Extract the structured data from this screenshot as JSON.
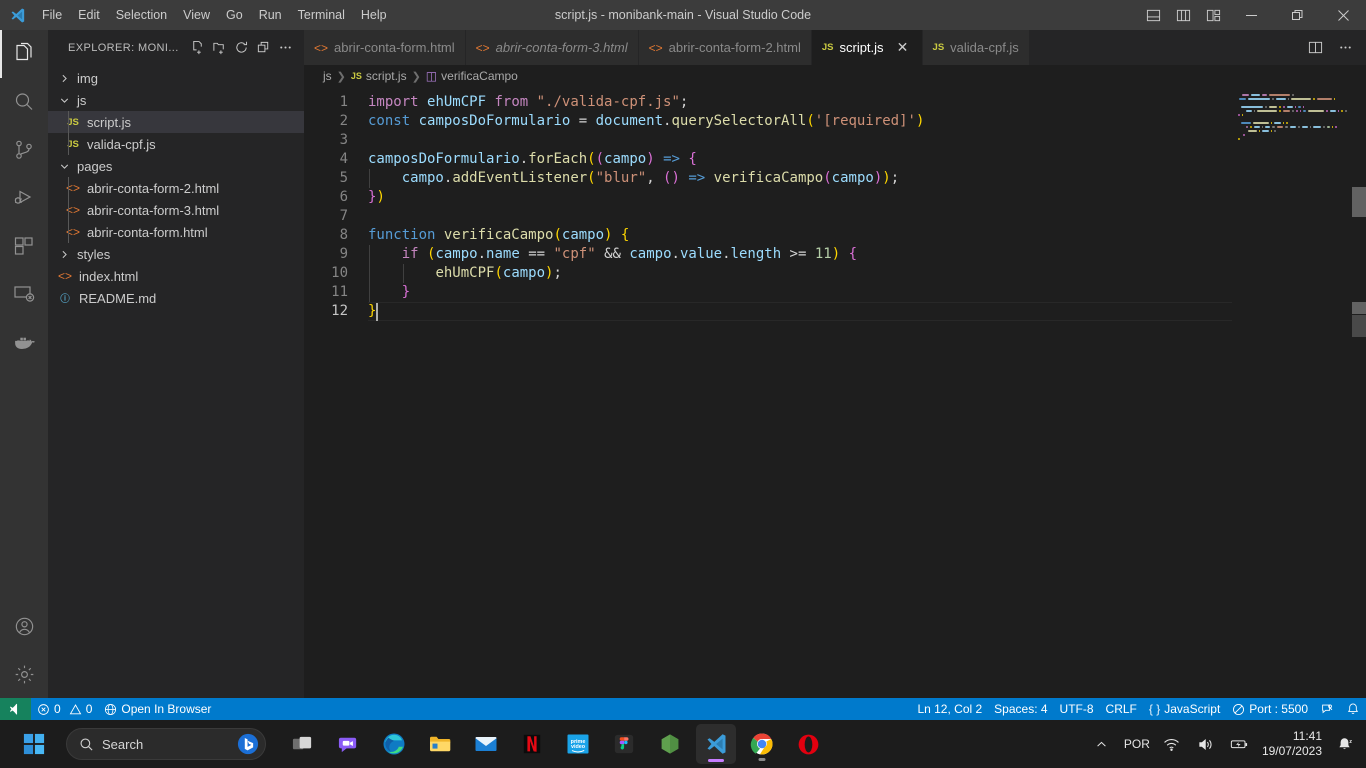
{
  "window": {
    "title": "script.js - monibank-main - Visual Studio Code",
    "menus": [
      "File",
      "Edit",
      "Selection",
      "View",
      "Go",
      "Run",
      "Terminal",
      "Help"
    ],
    "controls": {
      "minimize": "minimize-button",
      "restore": "restore-button",
      "close": "close-button"
    },
    "layout_toggles": [
      "toggle-primary-sidebar",
      "toggle-panel",
      "toggle-secondary-sidebar",
      "customize-layout"
    ]
  },
  "activitybar": {
    "items": [
      {
        "name": "explorer",
        "icon": "files-icon",
        "active": true
      },
      {
        "name": "search",
        "icon": "search-icon",
        "active": false
      },
      {
        "name": "source-control",
        "icon": "source-control-icon",
        "active": false
      },
      {
        "name": "run-and-debug",
        "icon": "debug-icon",
        "active": false
      },
      {
        "name": "extensions",
        "icon": "extensions-icon",
        "active": false
      },
      {
        "name": "remote-explorer",
        "icon": "remote-explorer-icon",
        "active": false
      },
      {
        "name": "docker",
        "icon": "docker-icon",
        "active": false
      }
    ],
    "bottom": [
      {
        "name": "accounts",
        "icon": "account-icon"
      },
      {
        "name": "manage-settings",
        "icon": "gear-icon"
      }
    ]
  },
  "sidebar": {
    "header": "EXPLORER: MONI...",
    "actions": [
      "new-file-icon",
      "new-folder-icon",
      "refresh-icon",
      "collapse-all-icon",
      "more-actions-icon"
    ],
    "tree": [
      {
        "label": "img",
        "type": "folder",
        "expanded": false,
        "indent": 0,
        "selected": false
      },
      {
        "label": "js",
        "type": "folder",
        "expanded": true,
        "indent": 0,
        "selected": false
      },
      {
        "label": "script.js",
        "type": "js",
        "indent": 1,
        "selected": true
      },
      {
        "label": "valida-cpf.js",
        "type": "js",
        "indent": 1,
        "selected": false
      },
      {
        "label": "pages",
        "type": "folder",
        "expanded": true,
        "indent": 0,
        "selected": false
      },
      {
        "label": "abrir-conta-form-2.html",
        "type": "html",
        "indent": 1,
        "selected": false
      },
      {
        "label": "abrir-conta-form-3.html",
        "type": "html",
        "indent": 1,
        "selected": false
      },
      {
        "label": "abrir-conta-form.html",
        "type": "html",
        "indent": 1,
        "selected": false
      },
      {
        "label": "styles",
        "type": "folder",
        "expanded": false,
        "indent": 0,
        "selected": false
      },
      {
        "label": "index.html",
        "type": "html",
        "indent": 0,
        "selected": false
      },
      {
        "label": "README.md",
        "type": "md",
        "indent": 0,
        "selected": false
      }
    ]
  },
  "tabs": [
    {
      "label": "abrir-conta-form.html",
      "type": "html",
      "active": false,
      "preview": false,
      "closable": false
    },
    {
      "label": "abrir-conta-form-3.html",
      "type": "html",
      "active": false,
      "preview": true,
      "closable": false
    },
    {
      "label": "abrir-conta-form-2.html",
      "type": "html",
      "active": false,
      "preview": false,
      "closable": false
    },
    {
      "label": "script.js",
      "type": "js",
      "active": true,
      "preview": false,
      "closable": true
    },
    {
      "label": "valida-cpf.js",
      "type": "js",
      "active": false,
      "preview": false,
      "closable": false
    }
  ],
  "tabbar_actions": [
    "split-editor-icon",
    "more-editor-actions-icon"
  ],
  "breadcrumb": {
    "folder": "js",
    "file": "script.js",
    "symbol": "verificaCampo"
  },
  "editor": {
    "language": "JavaScript",
    "line_count": 12,
    "cursor_line": 12,
    "lines": [
      {
        "n": 1,
        "tokens": [
          {
            "t": "import",
            "c": "k-import"
          },
          {
            "t": " ",
            "c": "k-op"
          },
          {
            "t": "ehUmCPF",
            "c": "k-var"
          },
          {
            "t": " ",
            "c": "k-op"
          },
          {
            "t": "from",
            "c": "k-import"
          },
          {
            "t": " ",
            "c": "k-op"
          },
          {
            "t": "\"./valida-cpf.js\"",
            "c": "k-str"
          },
          {
            "t": ";",
            "c": "k-op"
          }
        ]
      },
      {
        "n": 2,
        "tokens": [
          {
            "t": "const",
            "c": "k-kw"
          },
          {
            "t": " ",
            "c": "k-op"
          },
          {
            "t": "camposDoFormulario",
            "c": "k-var"
          },
          {
            "t": " = ",
            "c": "k-op"
          },
          {
            "t": "document",
            "c": "k-var"
          },
          {
            "t": ".",
            "c": "k-op"
          },
          {
            "t": "querySelectorAll",
            "c": "k-fn"
          },
          {
            "t": "(",
            "c": "k-p1"
          },
          {
            "t": "'[required]'",
            "c": "k-str"
          },
          {
            "t": ")",
            "c": "k-p1"
          }
        ]
      },
      {
        "n": 3,
        "tokens": []
      },
      {
        "n": 4,
        "tokens": [
          {
            "t": "camposDoFormulario",
            "c": "k-var"
          },
          {
            "t": ".",
            "c": "k-op"
          },
          {
            "t": "forEach",
            "c": "k-fn"
          },
          {
            "t": "(",
            "c": "k-p1"
          },
          {
            "t": "(",
            "c": "k-p2"
          },
          {
            "t": "campo",
            "c": "k-var"
          },
          {
            "t": ")",
            "c": "k-p2"
          },
          {
            "t": " ",
            "c": "k-op"
          },
          {
            "t": "=>",
            "c": "k-kw"
          },
          {
            "t": " ",
            "c": "k-op"
          },
          {
            "t": "{",
            "c": "k-p2"
          }
        ]
      },
      {
        "n": 5,
        "tokens": [
          {
            "t": "    ",
            "c": "k-op"
          },
          {
            "t": "campo",
            "c": "k-var"
          },
          {
            "t": ".",
            "c": "k-op"
          },
          {
            "t": "addEventListener",
            "c": "k-fn"
          },
          {
            "t": "(",
            "c": "k-p1"
          },
          {
            "t": "\"blur\"",
            "c": "k-str"
          },
          {
            "t": ", ",
            "c": "k-op"
          },
          {
            "t": "(",
            "c": "k-p2"
          },
          {
            "t": ")",
            "c": "k-p2"
          },
          {
            "t": " ",
            "c": "k-op"
          },
          {
            "t": "=>",
            "c": "k-kw"
          },
          {
            "t": " ",
            "c": "k-op"
          },
          {
            "t": "verificaCampo",
            "c": "k-fn"
          },
          {
            "t": "(",
            "c": "k-p2"
          },
          {
            "t": "campo",
            "c": "k-var"
          },
          {
            "t": ")",
            "c": "k-p2"
          },
          {
            "t": ")",
            "c": "k-p1"
          },
          {
            "t": ";",
            "c": "k-op"
          }
        ]
      },
      {
        "n": 6,
        "tokens": [
          {
            "t": "}",
            "c": "k-p2"
          },
          {
            "t": ")",
            "c": "k-p1"
          }
        ]
      },
      {
        "n": 7,
        "tokens": []
      },
      {
        "n": 8,
        "tokens": [
          {
            "t": "function",
            "c": "k-kw"
          },
          {
            "t": " ",
            "c": "k-op"
          },
          {
            "t": "verificaCampo",
            "c": "k-fn"
          },
          {
            "t": "(",
            "c": "k-p1"
          },
          {
            "t": "campo",
            "c": "k-var"
          },
          {
            "t": ")",
            "c": "k-p1"
          },
          {
            "t": " ",
            "c": "k-op"
          },
          {
            "t": "{",
            "c": "k-p1"
          }
        ]
      },
      {
        "n": 9,
        "tokens": [
          {
            "t": "    ",
            "c": "k-op"
          },
          {
            "t": "if",
            "c": "k-ctrl"
          },
          {
            "t": " ",
            "c": "k-op"
          },
          {
            "t": "(",
            "c": "k-p1"
          },
          {
            "t": "campo",
            "c": "k-var"
          },
          {
            "t": ".",
            "c": "k-op"
          },
          {
            "t": "name",
            "c": "k-var"
          },
          {
            "t": " == ",
            "c": "k-op"
          },
          {
            "t": "\"cpf\"",
            "c": "k-str"
          },
          {
            "t": " && ",
            "c": "k-op"
          },
          {
            "t": "campo",
            "c": "k-var"
          },
          {
            "t": ".",
            "c": "k-op"
          },
          {
            "t": "value",
            "c": "k-var"
          },
          {
            "t": ".",
            "c": "k-op"
          },
          {
            "t": "length",
            "c": "k-var"
          },
          {
            "t": " >= ",
            "c": "k-op"
          },
          {
            "t": "11",
            "c": "k-num"
          },
          {
            "t": ")",
            "c": "k-p1"
          },
          {
            "t": " ",
            "c": "k-op"
          },
          {
            "t": "{",
            "c": "k-p2"
          }
        ]
      },
      {
        "n": 10,
        "tokens": [
          {
            "t": "        ",
            "c": "k-op"
          },
          {
            "t": "ehUmCPF",
            "c": "k-fn"
          },
          {
            "t": "(",
            "c": "k-p1"
          },
          {
            "t": "campo",
            "c": "k-var"
          },
          {
            "t": ")",
            "c": "k-p1"
          },
          {
            "t": ";",
            "c": "k-op"
          }
        ]
      },
      {
        "n": 11,
        "tokens": [
          {
            "t": "    ",
            "c": "k-op"
          },
          {
            "t": "}",
            "c": "k-p2"
          }
        ]
      },
      {
        "n": 12,
        "tokens": [
          {
            "t": "}",
            "c": "k-p1"
          }
        ]
      }
    ]
  },
  "statusbar": {
    "remote_icon": "remote-window-icon",
    "problems": {
      "errors": "0",
      "warnings": "0"
    },
    "open_in_browser": "Open In Browser",
    "position": "Ln 12, Col 2",
    "indentation": "Spaces: 4",
    "encoding": "UTF-8",
    "eol": "CRLF",
    "language": "JavaScript",
    "port": "Port : 5500",
    "feedback_icon": "tweet-feedback-icon",
    "notifications_icon": "bell-icon"
  },
  "taskbar": {
    "start": "start-button",
    "search_placeholder": "Search",
    "apps": [
      {
        "name": "task-view",
        "label": "Task View",
        "active": false
      },
      {
        "name": "chat",
        "label": "Chat",
        "active": false
      },
      {
        "name": "edge",
        "label": "Microsoft Edge",
        "active": false
      },
      {
        "name": "file-explorer",
        "label": "File Explorer",
        "active": false
      },
      {
        "name": "mail",
        "label": "Mail",
        "active": false
      },
      {
        "name": "netflix",
        "label": "Netflix",
        "active": false
      },
      {
        "name": "prime-video",
        "label": "Prime Video",
        "active": false
      },
      {
        "name": "figma",
        "label": "Figma",
        "active": false
      },
      {
        "name": "nodejs",
        "label": "Node.js",
        "active": false
      },
      {
        "name": "vscode",
        "label": "Visual Studio Code",
        "active": true
      },
      {
        "name": "chrome",
        "label": "Google Chrome",
        "active": false,
        "running": true
      },
      {
        "name": "opera",
        "label": "Opera",
        "active": false
      }
    ],
    "tray": {
      "overflow_icon": "chevron-up-icon",
      "language": "POR",
      "wifi_icon": "wifi-icon",
      "volume_icon": "volume-icon",
      "battery_icon": "battery-charging-icon",
      "time": "11:41",
      "date": "19/07/2023",
      "notification_icon": "bell-badge-icon"
    }
  }
}
